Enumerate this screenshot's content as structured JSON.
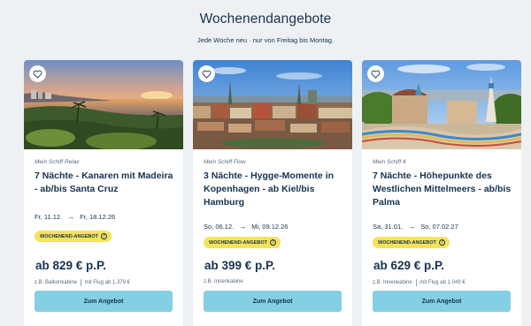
{
  "header": {
    "title": "Wochenendangebote",
    "subtitle": "Jede Woche neu · nur von Freitag bis Montag."
  },
  "cards": [
    {
      "ship": "Mein Schiff Relax",
      "title": "7 Nächte - Kanaren mit Madeira - ab/bis Santa Cruz",
      "date_from": "Fr, 11.12.",
      "date_to": "Fr, 18.12.26",
      "badge": "WOCHENEND-ANGEBOT",
      "price": "ab 829 € p.P.",
      "cabin": "z.B. Balkonkabine",
      "flight": "mit Flug ab 1.379 €",
      "cta": "Zum Angebot",
      "image": "canary-coast-sunset"
    },
    {
      "ship": "Mein Schiff Flow",
      "title": "3 Nächte - Hygge-Momente in Kopenhagen - ab Kiel/bis Hamburg",
      "date_from": "So, 06.12.",
      "date_to": "Mi, 09.12.26",
      "badge": "WOCHENEND-ANGEBOT",
      "price": "ab 399 € p.P.",
      "cabin": "z.B. Innenkabine",
      "flight": "",
      "cta": "Zum Angebot",
      "image": "copenhagen-skyline"
    },
    {
      "ship": "Mein Schiff 4",
      "title": "7 Nächte - Höhepunkte des Westlichen Mittelmeers - ab/bis Palma",
      "date_from": "Sa, 31.01.",
      "date_to": "So, 07.02.27",
      "badge": "WOCHENEND-ANGEBOT",
      "price": "ab 629 € p.P.",
      "cabin": "z.B. Innenkabine",
      "flight": "mit Flug ab 1.049 €",
      "cta": "Zum Angebot",
      "image": "barcelona-park-guell"
    }
  ],
  "icons": {
    "favorite": "heart-icon",
    "date_arrow": "arrow-right-icon",
    "badge_info": "question-circle-icon"
  },
  "colors": {
    "badge": "#f7e35a",
    "cta": "#84cfe3",
    "text": "#16334f",
    "background": "#eef1f4"
  }
}
